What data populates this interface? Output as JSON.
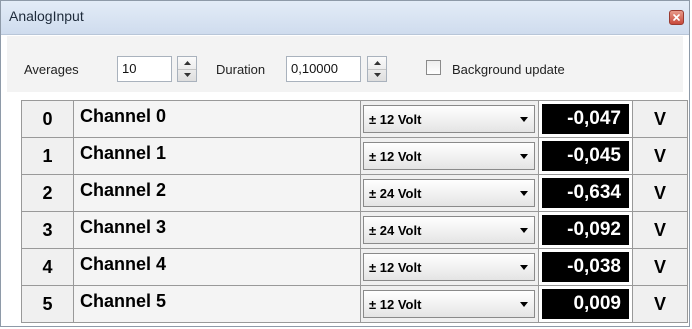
{
  "window": {
    "title": "AnalogInput"
  },
  "toolbar": {
    "averages_label": "Averages",
    "averages_value": "10",
    "duration_label": "Duration",
    "duration_value": "0,10000",
    "background_update_label": "Background update",
    "background_update_checked": false
  },
  "channels": [
    {
      "index": "0",
      "name": "Channel 0",
      "range": "± 12 Volt",
      "value": "-0,047",
      "unit": "V"
    },
    {
      "index": "1",
      "name": "Channel 1",
      "range": "± 12 Volt",
      "value": "-0,045",
      "unit": "V"
    },
    {
      "index": "2",
      "name": "Channel 2",
      "range": "± 24 Volt",
      "value": "-0,634",
      "unit": "V"
    },
    {
      "index": "3",
      "name": "Channel 3",
      "range": "± 24 Volt",
      "value": "-0,092",
      "unit": "V"
    },
    {
      "index": "4",
      "name": "Channel 4",
      "range": "± 12 Volt",
      "value": "-0,038",
      "unit": "V"
    },
    {
      "index": "5",
      "name": "Channel 5",
      "range": "± 12 Volt",
      "value": "0,009",
      "unit": "V"
    }
  ],
  "icons": {
    "close": "close-icon",
    "spinner": "spinner-arrows-icon",
    "dropdown": "chevron-down-icon"
  },
  "colors": {
    "value_background": "#000000",
    "value_text": "#ffffff"
  }
}
